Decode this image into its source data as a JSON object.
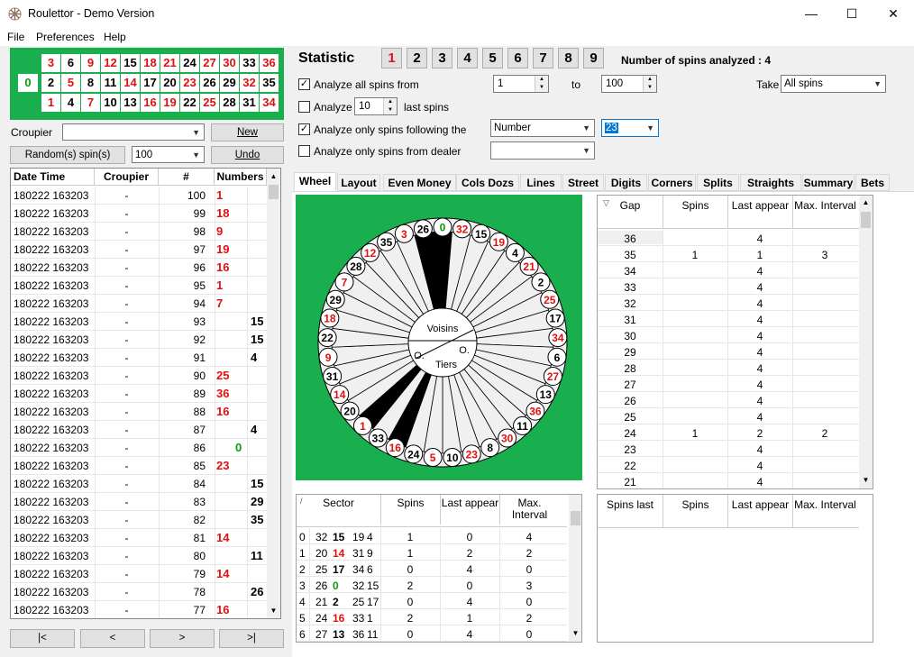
{
  "window": {
    "title": "Roulettor - Demo Version",
    "min": "—",
    "max": "☐",
    "close": "✕"
  },
  "menu": [
    "File",
    "Preferences",
    "Help"
  ],
  "board": {
    "zero": "0",
    "rows": [
      [
        {
          "n": "3",
          "c": "r"
        },
        {
          "n": "6",
          "c": "b"
        },
        {
          "n": "9",
          "c": "r"
        },
        {
          "n": "12",
          "c": "r"
        },
        {
          "n": "15",
          "c": "b"
        },
        {
          "n": "18",
          "c": "r"
        },
        {
          "n": "21",
          "c": "r"
        },
        {
          "n": "24",
          "c": "b"
        },
        {
          "n": "27",
          "c": "r"
        },
        {
          "n": "30",
          "c": "r"
        },
        {
          "n": "33",
          "c": "b"
        },
        {
          "n": "36",
          "c": "r"
        }
      ],
      [
        {
          "n": "2",
          "c": "b"
        },
        {
          "n": "5",
          "c": "r"
        },
        {
          "n": "8",
          "c": "b"
        },
        {
          "n": "11",
          "c": "b"
        },
        {
          "n": "14",
          "c": "r"
        },
        {
          "n": "17",
          "c": "b"
        },
        {
          "n": "20",
          "c": "b"
        },
        {
          "n": "23",
          "c": "r"
        },
        {
          "n": "26",
          "c": "b"
        },
        {
          "n": "29",
          "c": "b"
        },
        {
          "n": "32",
          "c": "r"
        },
        {
          "n": "35",
          "c": "b"
        }
      ],
      [
        {
          "n": "1",
          "c": "r"
        },
        {
          "n": "4",
          "c": "b"
        },
        {
          "n": "7",
          "c": "r"
        },
        {
          "n": "10",
          "c": "b"
        },
        {
          "n": "13",
          "c": "b"
        },
        {
          "n": "16",
          "c": "r"
        },
        {
          "n": "19",
          "c": "r"
        },
        {
          "n": "22",
          "c": "b"
        },
        {
          "n": "25",
          "c": "r"
        },
        {
          "n": "28",
          "c": "b"
        },
        {
          "n": "31",
          "c": "b"
        },
        {
          "n": "34",
          "c": "r"
        }
      ]
    ]
  },
  "left": {
    "croupier_label": "Croupier",
    "new_btn": "New",
    "random_btn": "Random(s) spin(s)",
    "random_count": "100",
    "undo_btn": "Undo",
    "headers": [
      "Date Time",
      "Croupier",
      "#",
      "Numbers"
    ],
    "rows": [
      {
        "d": "180222 163203",
        "c": "-",
        "n": "100",
        "v": "1",
        "col": "r"
      },
      {
        "d": "180222 163203",
        "c": "-",
        "n": "99",
        "v": "18",
        "col": "r"
      },
      {
        "d": "180222 163203",
        "c": "-",
        "n": "98",
        "v": "9",
        "col": "r"
      },
      {
        "d": "180222 163203",
        "c": "-",
        "n": "97",
        "v": "19",
        "col": "r"
      },
      {
        "d": "180222 163203",
        "c": "-",
        "n": "96",
        "v": "16",
        "col": "r"
      },
      {
        "d": "180222 163203",
        "c": "-",
        "n": "95",
        "v": "1",
        "col": "r"
      },
      {
        "d": "180222 163203",
        "c": "-",
        "n": "94",
        "v": "7",
        "col": "r"
      },
      {
        "d": "180222 163203",
        "c": "-",
        "n": "93",
        "v": "15",
        "col": "b"
      },
      {
        "d": "180222 163203",
        "c": "-",
        "n": "92",
        "v": "15",
        "col": "b"
      },
      {
        "d": "180222 163203",
        "c": "-",
        "n": "91",
        "v": "4",
        "col": "b"
      },
      {
        "d": "180222 163203",
        "c": "-",
        "n": "90",
        "v": "25",
        "col": "r"
      },
      {
        "d": "180222 163203",
        "c": "-",
        "n": "89",
        "v": "36",
        "col": "r"
      },
      {
        "d": "180222 163203",
        "c": "-",
        "n": "88",
        "v": "16",
        "col": "r"
      },
      {
        "d": "180222 163203",
        "c": "-",
        "n": "87",
        "v": "4",
        "col": "b"
      },
      {
        "d": "180222 163203",
        "c": "-",
        "n": "86",
        "v": "0",
        "col": "g"
      },
      {
        "d": "180222 163203",
        "c": "-",
        "n": "85",
        "v": "23",
        "col": "r"
      },
      {
        "d": "180222 163203",
        "c": "-",
        "n": "84",
        "v": "15",
        "col": "b"
      },
      {
        "d": "180222 163203",
        "c": "-",
        "n": "83",
        "v": "29",
        "col": "b"
      },
      {
        "d": "180222 163203",
        "c": "-",
        "n": "82",
        "v": "35",
        "col": "b"
      },
      {
        "d": "180222 163203",
        "c": "-",
        "n": "81",
        "v": "14",
        "col": "r"
      },
      {
        "d": "180222 163203",
        "c": "-",
        "n": "80",
        "v": "11",
        "col": "b"
      },
      {
        "d": "180222 163203",
        "c": "-",
        "n": "79",
        "v": "14",
        "col": "r"
      },
      {
        "d": "180222 163203",
        "c": "-",
        "n": "78",
        "v": "26",
        "col": "b"
      },
      {
        "d": "180222 163203",
        "c": "-",
        "n": "77",
        "v": "16",
        "col": "r"
      }
    ],
    "nav": [
      "|<",
      "<",
      ">",
      ">|"
    ]
  },
  "stat": {
    "title": "Statistic",
    "buttons": [
      "1",
      "2",
      "3",
      "4",
      "5",
      "6",
      "7",
      "8",
      "9"
    ],
    "spins_analyzed": "Number of spins analyzed : 4",
    "opt1": "Analyze all spins from",
    "from_val": "1",
    "to_label": "to",
    "to_val": "100",
    "take_label": "Take",
    "take_val": "All spins",
    "opt2": "Analyze",
    "last_val": "10",
    "last_label": "last spins",
    "opt3": "Analyze only spins following the",
    "follow_val": "Number",
    "follow_num": "23",
    "opt4": "Analyze only spins from dealer"
  },
  "tabs": [
    "Wheel",
    "Layout",
    "Even Money",
    "Cols Dozs",
    "Lines",
    "Street",
    "Digits",
    "Corners",
    "Splits",
    "Straights",
    "Summary",
    "Bets"
  ],
  "wheel": {
    "order": [
      "0",
      "32",
      "15",
      "19",
      "4",
      "21",
      "2",
      "25",
      "17",
      "34",
      "6",
      "27",
      "13",
      "36",
      "11",
      "30",
      "8",
      "23",
      "10",
      "5",
      "24",
      "16",
      "33",
      "1",
      "20",
      "14",
      "31",
      "9",
      "22",
      "18",
      "29",
      "7",
      "28",
      "12",
      "35",
      "3",
      "26"
    ],
    "reds": [
      "32",
      "19",
      "21",
      "25",
      "34",
      "27",
      "36",
      "30",
      "23",
      "5",
      "16",
      "1",
      "14",
      "9",
      "18",
      "7",
      "12",
      "3"
    ],
    "hits": [
      "0",
      "1",
      "16",
      "26"
    ],
    "center": {
      "voisins": "Voisins",
      "tiers": "Tiers",
      "o1": "O.",
      "o2": "O."
    }
  },
  "sector": {
    "headers": [
      "Sector",
      "Spins",
      "Last appear",
      "Max. Interval"
    ],
    "rows": [
      {
        "i": "0",
        "a": "32",
        "b": "15",
        "c": "19",
        "d": "4",
        "bc": "b",
        "s": "1",
        "l": "0",
        "m": "4"
      },
      {
        "i": "1",
        "a": "20",
        "b": "14",
        "c": "31",
        "d": "9",
        "bc": "r",
        "s": "1",
        "l": "2",
        "m": "2"
      },
      {
        "i": "2",
        "a": "25",
        "b": "17",
        "c": "34",
        "d": "6",
        "bc": "b",
        "s": "0",
        "l": "4",
        "m": "0"
      },
      {
        "i": "3",
        "a": "26",
        "b": "0",
        "c": "32",
        "d": "15",
        "bc": "g",
        "s": "2",
        "l": "0",
        "m": "3"
      },
      {
        "i": "4",
        "a": "21",
        "b": "2",
        "c": "25",
        "d": "17",
        "bc": "b",
        "s": "0",
        "l": "4",
        "m": "0"
      },
      {
        "i": "5",
        "a": "24",
        "b": "16",
        "c": "33",
        "d": "1",
        "bc": "r",
        "s": "2",
        "l": "1",
        "m": "2"
      },
      {
        "i": "6",
        "a": "27",
        "b": "13",
        "c": "36",
        "d": "11",
        "bc": "b",
        "s": "0",
        "l": "4",
        "m": "0"
      }
    ]
  },
  "gap": {
    "headers": [
      "Gap",
      "Spins",
      "Last appear",
      "Max. Interval"
    ],
    "rows": [
      {
        "g": "36",
        "s": "",
        "l": "4",
        "m": ""
      },
      {
        "g": "35",
        "s": "1",
        "l": "1",
        "m": "3"
      },
      {
        "g": "34",
        "s": "",
        "l": "4",
        "m": ""
      },
      {
        "g": "33",
        "s": "",
        "l": "4",
        "m": ""
      },
      {
        "g": "32",
        "s": "",
        "l": "4",
        "m": ""
      },
      {
        "g": "31",
        "s": "",
        "l": "4",
        "m": ""
      },
      {
        "g": "30",
        "s": "",
        "l": "4",
        "m": ""
      },
      {
        "g": "29",
        "s": "",
        "l": "4",
        "m": ""
      },
      {
        "g": "28",
        "s": "",
        "l": "4",
        "m": ""
      },
      {
        "g": "27",
        "s": "",
        "l": "4",
        "m": ""
      },
      {
        "g": "26",
        "s": "",
        "l": "4",
        "m": ""
      },
      {
        "g": "25",
        "s": "",
        "l": "4",
        "m": ""
      },
      {
        "g": "24",
        "s": "1",
        "l": "2",
        "m": "2"
      },
      {
        "g": "23",
        "s": "",
        "l": "4",
        "m": ""
      },
      {
        "g": "22",
        "s": "",
        "l": "4",
        "m": ""
      },
      {
        "g": "21",
        "s": "",
        "l": "4",
        "m": ""
      }
    ]
  },
  "spinslast": {
    "headers": [
      "Spins last",
      "Spins",
      "Last appear",
      "Max. Interval"
    ]
  },
  "colors": {
    "green": "#1aaf4e",
    "red": "#e01010",
    "zero_green": "#0a9a0a",
    "accent_red": "#e81123"
  }
}
